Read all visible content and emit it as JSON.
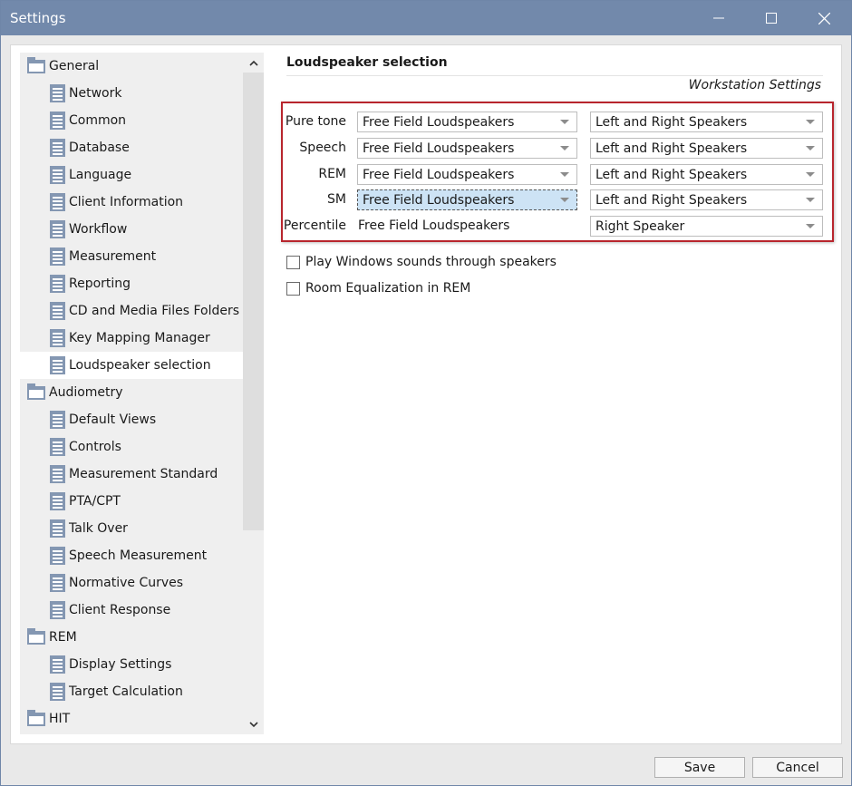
{
  "window": {
    "title": "Settings"
  },
  "tree": {
    "items": [
      {
        "label": "General",
        "level": 0,
        "type": "folder"
      },
      {
        "label": "Network",
        "level": 1,
        "type": "page"
      },
      {
        "label": "Common",
        "level": 1,
        "type": "page"
      },
      {
        "label": "Database",
        "level": 1,
        "type": "page"
      },
      {
        "label": "Language",
        "level": 1,
        "type": "page"
      },
      {
        "label": "Client Information",
        "level": 1,
        "type": "page"
      },
      {
        "label": "Workflow",
        "level": 1,
        "type": "page"
      },
      {
        "label": "Measurement",
        "level": 1,
        "type": "page"
      },
      {
        "label": "Reporting",
        "level": 1,
        "type": "page"
      },
      {
        "label": "CD and Media Files Folders",
        "level": 1,
        "type": "page"
      },
      {
        "label": "Key Mapping Manager",
        "level": 1,
        "type": "page"
      },
      {
        "label": "Loudspeaker selection",
        "level": 1,
        "type": "page",
        "selected": true
      },
      {
        "label": "Audiometry",
        "level": 0,
        "type": "folder"
      },
      {
        "label": "Default Views",
        "level": 1,
        "type": "page"
      },
      {
        "label": "Controls",
        "level": 1,
        "type": "page"
      },
      {
        "label": "Measurement Standard",
        "level": 1,
        "type": "page"
      },
      {
        "label": "PTA/CPT",
        "level": 1,
        "type": "page"
      },
      {
        "label": "Talk Over",
        "level": 1,
        "type": "page"
      },
      {
        "label": "Speech Measurement",
        "level": 1,
        "type": "page"
      },
      {
        "label": "Normative Curves",
        "level": 1,
        "type": "page"
      },
      {
        "label": "Client Response",
        "level": 1,
        "type": "page"
      },
      {
        "label": "REM",
        "level": 0,
        "type": "folder"
      },
      {
        "label": "Display Settings",
        "level": 1,
        "type": "page"
      },
      {
        "label": "Target Calculation",
        "level": 1,
        "type": "page"
      },
      {
        "label": "HIT",
        "level": 0,
        "type": "folder"
      }
    ]
  },
  "content": {
    "title": "Loudspeaker selection",
    "subtitle": "Workstation Settings",
    "rows": [
      {
        "label": "Pure tone",
        "device": "Free Field Loudspeakers",
        "speakers": "Left and Right Speakers"
      },
      {
        "label": "Speech",
        "device": "Free Field Loudspeakers",
        "speakers": "Left and Right Speakers"
      },
      {
        "label": "REM",
        "device": "Free Field Loudspeakers",
        "speakers": "Left and Right Speakers"
      },
      {
        "label": "SM",
        "device": "Free Field Loudspeakers",
        "speakers": "Left and Right Speakers"
      },
      {
        "label": "Percentile",
        "device": "Free Field Loudspeakers",
        "speakers": "Right Speaker"
      }
    ],
    "options": [
      {
        "label": "Play Windows sounds through speakers",
        "checked": false
      },
      {
        "label": "Room Equalization in REM",
        "checked": false
      }
    ]
  },
  "footer": {
    "save_label": "Save",
    "cancel_label": "Cancel"
  },
  "colors": {
    "titlebar": "#7289ab",
    "highlight": "#b8252d",
    "icon": "#8497b2"
  }
}
